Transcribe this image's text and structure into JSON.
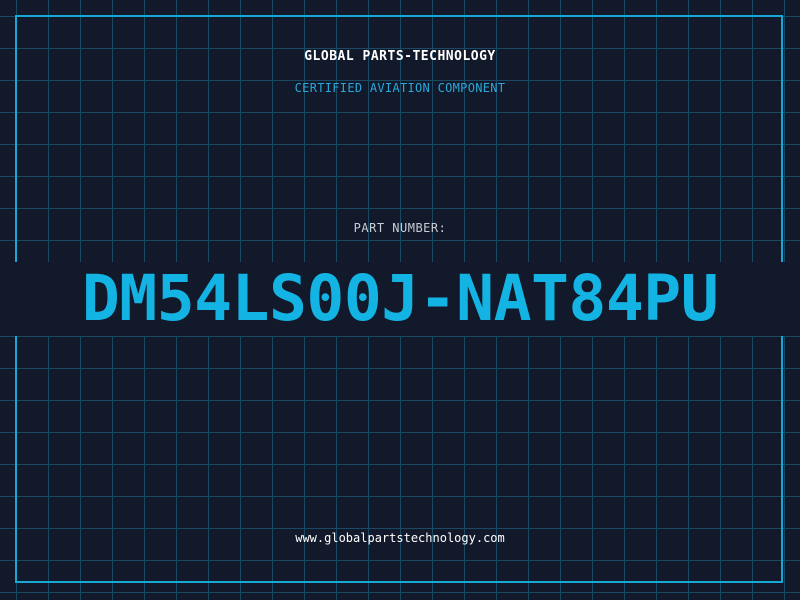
{
  "header": {
    "company": "GLOBAL PARTS-TECHNOLOGY",
    "subtitle": "CERTIFIED AVIATION COMPONENT"
  },
  "part": {
    "label": "PART NUMBER:",
    "number": "DM54LS00J-NAT84PU"
  },
  "footer": {
    "url": "www.globalpartstechnology.com"
  },
  "colors": {
    "background": "#12192b",
    "grid": "#1a4a63",
    "accent": "#13b3e3",
    "text": "#ffffff"
  }
}
